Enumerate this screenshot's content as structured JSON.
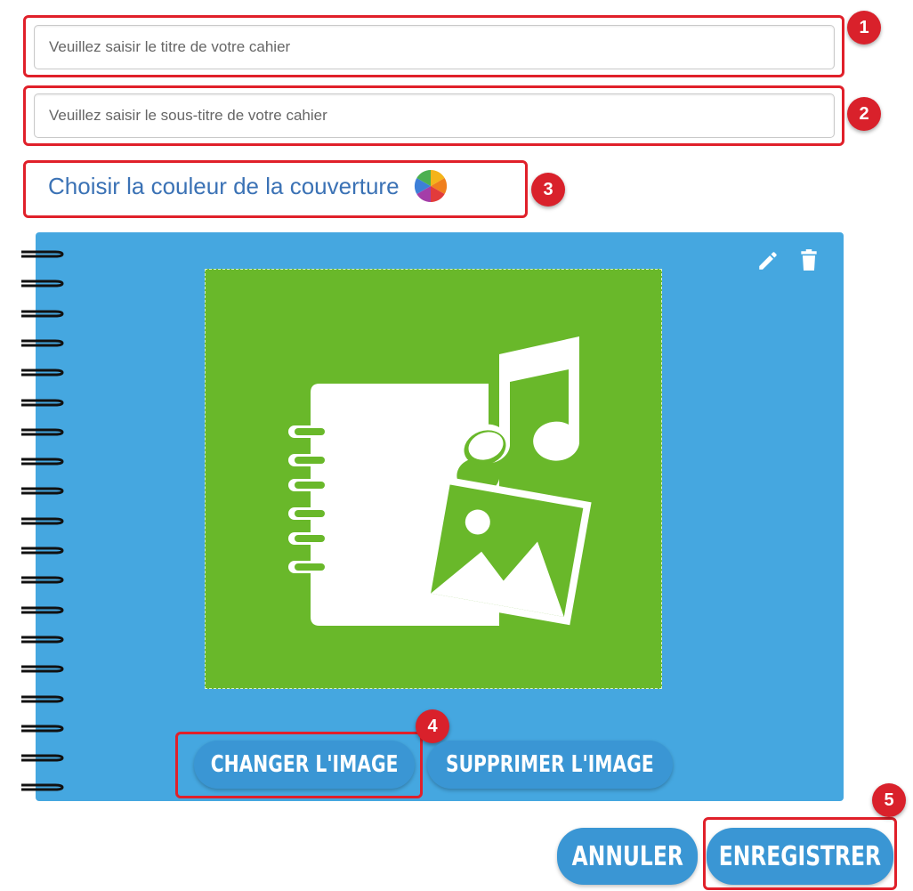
{
  "title_field": {
    "placeholder": "Veuillez saisir le titre de votre cahier",
    "value": ""
  },
  "subtitle_field": {
    "placeholder": "Veuillez saisir le sous-titre de votre cahier",
    "value": ""
  },
  "cover_color": {
    "label": "Choisir la couleur de la couverture",
    "icon": "color-wheel-icon"
  },
  "cover": {
    "background_color": "#45a7e0",
    "image_background_color": "#69b82a",
    "image_icon": "notebook-music-image-icon",
    "edit_icon": "pencil-icon",
    "delete_icon": "trash-icon",
    "change_image_label": "CHANGER L'IMAGE",
    "remove_image_label": "SUPPRIMER L'IMAGE"
  },
  "actions": {
    "cancel_label": "ANNULER",
    "save_label": "ENREGISTRER"
  },
  "annotations": [
    "1",
    "2",
    "3",
    "4",
    "5"
  ],
  "colors": {
    "annotation_red": "#e0202a",
    "link_blue": "#3b72b5",
    "button_blue": "#3a96d4"
  }
}
